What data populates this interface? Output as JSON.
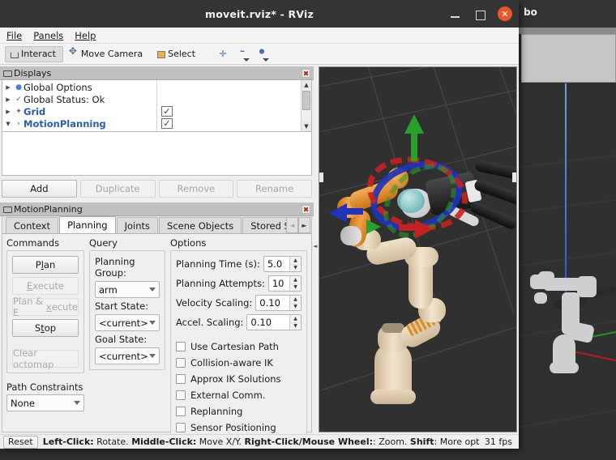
{
  "window": {
    "title": "moveit.rviz* - RViz",
    "controls": {
      "minimize": "–",
      "maximize": "□",
      "close": "✕"
    }
  },
  "background_window": {
    "visible_text": "bo"
  },
  "menubar": {
    "items": [
      "File",
      "Panels",
      "Help"
    ]
  },
  "toolbar": {
    "buttons": [
      {
        "label": "Interact",
        "icon": "interact-icon",
        "active": true
      },
      {
        "label": "Move Camera",
        "icon": "move-camera-icon",
        "active": false
      },
      {
        "label": "Select",
        "icon": "select-icon",
        "active": false
      }
    ],
    "mini_buttons": [
      {
        "icon": "focus-camera-icon",
        "has_dropdown": false
      },
      {
        "icon": "measure-icon",
        "has_dropdown": true
      },
      {
        "icon": "publish-point-icon",
        "has_dropdown": true
      }
    ]
  },
  "displays_panel": {
    "title": "Displays",
    "close_icon": "close-icon",
    "tree": [
      {
        "label": "Global Options",
        "bullet": "●",
        "arrow": "▶",
        "checkbox": null,
        "link": false
      },
      {
        "label": "Global Status: Ok",
        "bullet": "✓",
        "arrow": "▶",
        "checkbox": null,
        "link": false
      },
      {
        "label": "Grid",
        "bullet": "✦",
        "arrow": "▶",
        "checkbox": "✓",
        "link": true
      },
      {
        "label": "MotionPlanning",
        "bullet": "›",
        "arrow": "▼",
        "checkbox": "✓",
        "link": true
      }
    ],
    "buttons": [
      {
        "label": "Add",
        "enabled": true
      },
      {
        "label": "Duplicate",
        "enabled": false
      },
      {
        "label": "Remove",
        "enabled": false
      },
      {
        "label": "Rename",
        "enabled": false
      }
    ]
  },
  "motion_planning_panel": {
    "title": "MotionPlanning",
    "close_icon": "close-icon",
    "tabs": [
      {
        "label": "Context",
        "active": false
      },
      {
        "label": "Planning",
        "active": true
      },
      {
        "label": "Joints",
        "active": false
      },
      {
        "label": "Scene Objects",
        "active": false
      },
      {
        "label": "Stored Sc",
        "active": false
      }
    ],
    "tab_scroll_left": "◄",
    "tab_scroll_right": "►",
    "commands": {
      "title": "Commands",
      "buttons": [
        {
          "label": "Plan",
          "underline_index": 1,
          "enabled": true
        },
        {
          "label": "Execute",
          "underline_index": 0,
          "enabled": false
        },
        {
          "label": "Plan & Execute",
          "underline_index": 7,
          "enabled": false
        },
        {
          "label": "Stop",
          "underline_index": 1,
          "enabled": true
        },
        {
          "label": "Clear octomap",
          "underline_index": -1,
          "enabled": false
        }
      ]
    },
    "query": {
      "title": "Query",
      "fields": [
        {
          "label": "Planning Group:",
          "value": "arm"
        },
        {
          "label": "Start State:",
          "value": "<current>"
        },
        {
          "label": "Goal State:",
          "value": "<current>"
        }
      ]
    },
    "options": {
      "title": "Options",
      "spinners": [
        {
          "label": "Planning Time (s):",
          "value": "5.0"
        },
        {
          "label": "Planning Attempts:",
          "value": "10"
        },
        {
          "label": "Velocity Scaling:",
          "value": "0.10"
        },
        {
          "label": "Accel. Scaling:",
          "value": "0.10"
        }
      ],
      "checkboxes": [
        {
          "label": "Use Cartesian Path",
          "checked": false
        },
        {
          "label": "Collision-aware IK",
          "checked": false
        },
        {
          "label": "Approx IK Solutions",
          "checked": false
        },
        {
          "label": "External Comm.",
          "checked": false
        },
        {
          "label": "Replanning",
          "checked": false
        },
        {
          "label": "Sensor Positioning",
          "checked": false
        }
      ]
    },
    "path_constraints": {
      "title": "Path Constraints",
      "value": "None"
    }
  },
  "statusbar": {
    "reset_label": "Reset",
    "hint_segments": [
      {
        "text": "Left-Click:",
        "bold": true
      },
      {
        "text": " Rotate. ",
        "bold": false
      },
      {
        "text": "Middle-Click:",
        "bold": true
      },
      {
        "text": " Move X/Y. ",
        "bold": false
      },
      {
        "text": "Right-Click/Mouse Wheel:",
        "bold": true
      },
      {
        "text": ": Zoom. ",
        "bold": false
      },
      {
        "text": "Shift",
        "bold": true
      },
      {
        "text": ": More options.",
        "bold": false
      }
    ],
    "fps": "31 fps"
  },
  "viewport": {
    "background_color": "#303030",
    "grid_color": "#4a4a4a",
    "marker_axes": {
      "x": "#cc2222",
      "y": "#22aa22",
      "z": "#2222cc"
    },
    "robot_color": "#e8d5b8",
    "accent_color": "#e08a20"
  },
  "colors": {
    "titlebar_bg": "#343434",
    "close_button": "#e8562a",
    "panel_header": "#c0c0c0",
    "app_bg": "#efefef",
    "link_blue": "#2a5db0"
  }
}
